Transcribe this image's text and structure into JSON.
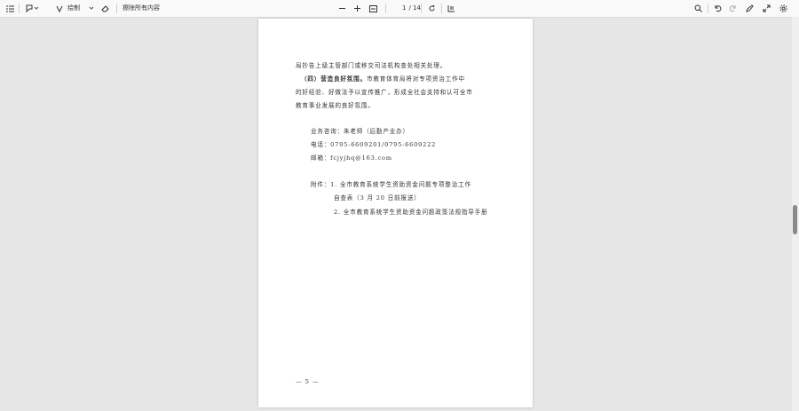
{
  "toolbar": {
    "annotate_label": "绘制",
    "erase_label": "擦除所有内容",
    "page_current": "1",
    "page_total": "/ 14"
  },
  "document": {
    "lines": [
      "局抄告上级主管部门或移交司法机构查处相关处理。",
      "（四）营造良好氛围。",
      "市教育体育局将对专项资治工作中",
      "的好经验、好做法予以宣传推广，形成全社会支持和认可全市",
      "教育事业发展的良好氛围。",
      "业务咨询：朱老师（后勤产业办）",
      "电话：0795-6609201/0795-6609222",
      "邮箱：fcjyjhq@163.com",
      "附件：1. 全市教育系统学生资助资金问题专项整治工作",
      "自查表（3 月 20 日前报送）",
      "2. 全市教育系统学生资助资金问题政策法规指导手册"
    ],
    "page_footer": "— 5 —"
  }
}
